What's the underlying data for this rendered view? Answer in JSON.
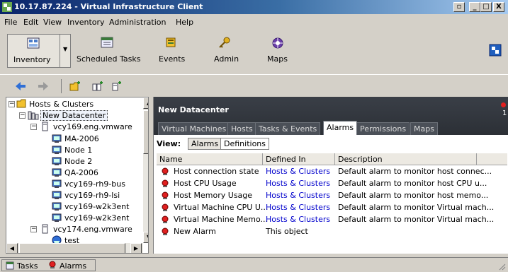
{
  "window": {
    "title": "10.17.87.224 - Virtual Infrastructure Client",
    "buttons": [
      "_",
      "□",
      "X"
    ]
  },
  "menu": [
    "File",
    "Edit",
    "View",
    "Inventory",
    "Administration",
    "Help"
  ],
  "toolbar": {
    "items": [
      "Inventory",
      "Scheduled Tasks",
      "Events",
      "Admin",
      "Maps"
    ]
  },
  "tree": {
    "items": [
      {
        "label": "Hosts & Clusters",
        "icon": "folder-icon"
      },
      {
        "label": "New Datacenter",
        "icon": "datacenter-icon"
      },
      {
        "label": "vcy169.eng.vmware",
        "icon": "host-icon"
      },
      {
        "label": "MA-2006",
        "icon": "vm-icon"
      },
      {
        "label": "Node 1",
        "icon": "vm-icon"
      },
      {
        "label": "Node 2",
        "icon": "vm-icon"
      },
      {
        "label": "QA-2006",
        "icon": "vm-icon"
      },
      {
        "label": "vcy169-rh9-bus",
        "icon": "vm-icon"
      },
      {
        "label": "vcy169-rh9-lsi",
        "icon": "vm-icon"
      },
      {
        "label": "vcy169-w2k3ent",
        "icon": "vm-icon"
      },
      {
        "label": "vcy169-w2k3ent",
        "icon": "vm-icon"
      },
      {
        "label": "vcy174.eng.vmware",
        "icon": "host-icon"
      },
      {
        "label": "test",
        "icon": "resource-pool-icon"
      }
    ]
  },
  "panel": {
    "title": "New Datacenter",
    "alarm_count": "1",
    "tabs": [
      "Virtual Machines",
      "Hosts",
      "Tasks & Events",
      "Alarms",
      "Permissions",
      "Maps"
    ],
    "active_tab": "Alarms",
    "view_label": "View:",
    "view_buttons": [
      "Alarms",
      "Definitions"
    ],
    "columns": [
      "Name",
      "Defined In",
      "Description"
    ],
    "rows": [
      {
        "name": "Host connection state",
        "defined_in": "Hosts & Clusters",
        "description": "Default alarm to monitor host connec..."
      },
      {
        "name": "Host CPU Usage",
        "defined_in": "Hosts & Clusters",
        "description": "Default alarm to monitor host CPU u..."
      },
      {
        "name": "Host Memory Usage",
        "defined_in": "Hosts & Clusters",
        "description": "Default alarm to monitor host memo..."
      },
      {
        "name": "Virtual Machine CPU U...",
        "defined_in": "Hosts & Clusters",
        "description": "Default alarm to monitor Virtual mach..."
      },
      {
        "name": "Virtual Machine Memo...",
        "defined_in": "Hosts & Clusters",
        "description": "Default alarm to monitor Virtual mach..."
      },
      {
        "name": "New Alarm",
        "defined_in": "This object",
        "description": ""
      }
    ]
  },
  "status": {
    "tasks": "Tasks",
    "alarms": "Alarms"
  }
}
